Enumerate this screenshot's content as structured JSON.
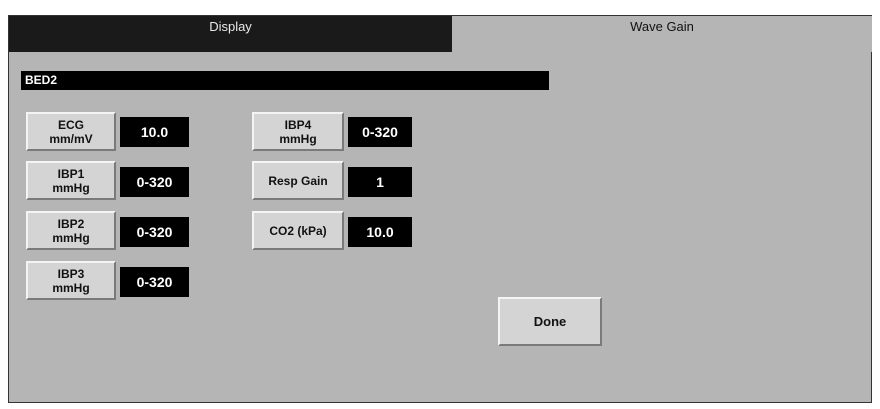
{
  "tabs": [
    {
      "label": "Display"
    },
    {
      "label": "Wave Gain"
    }
  ],
  "bed_label": "BED2",
  "left_column": [
    {
      "line1": "ECG",
      "line2": "mm/mV",
      "value": "10.0"
    },
    {
      "line1": "IBP1",
      "line2": "mmHg",
      "value": "0-320"
    },
    {
      "line1": "IBP2",
      "line2": "mmHg",
      "value": "0-320"
    },
    {
      "line1": "IBP3",
      "line2": "mmHg",
      "value": "0-320"
    }
  ],
  "right_column": [
    {
      "line1": "IBP4",
      "line2": "mmHg",
      "value": "0-320"
    },
    {
      "line1": "Resp Gain",
      "line2": "",
      "value": "1"
    },
    {
      "line1": "CO2 (kPa)",
      "line2": "",
      "value": "10.0"
    }
  ],
  "done_label": "Done",
  "colors": {
    "panel": "#b5b5b5",
    "active_tab": "#1a1a1a",
    "value_box": "#000000",
    "button": "#d4d4d4"
  }
}
